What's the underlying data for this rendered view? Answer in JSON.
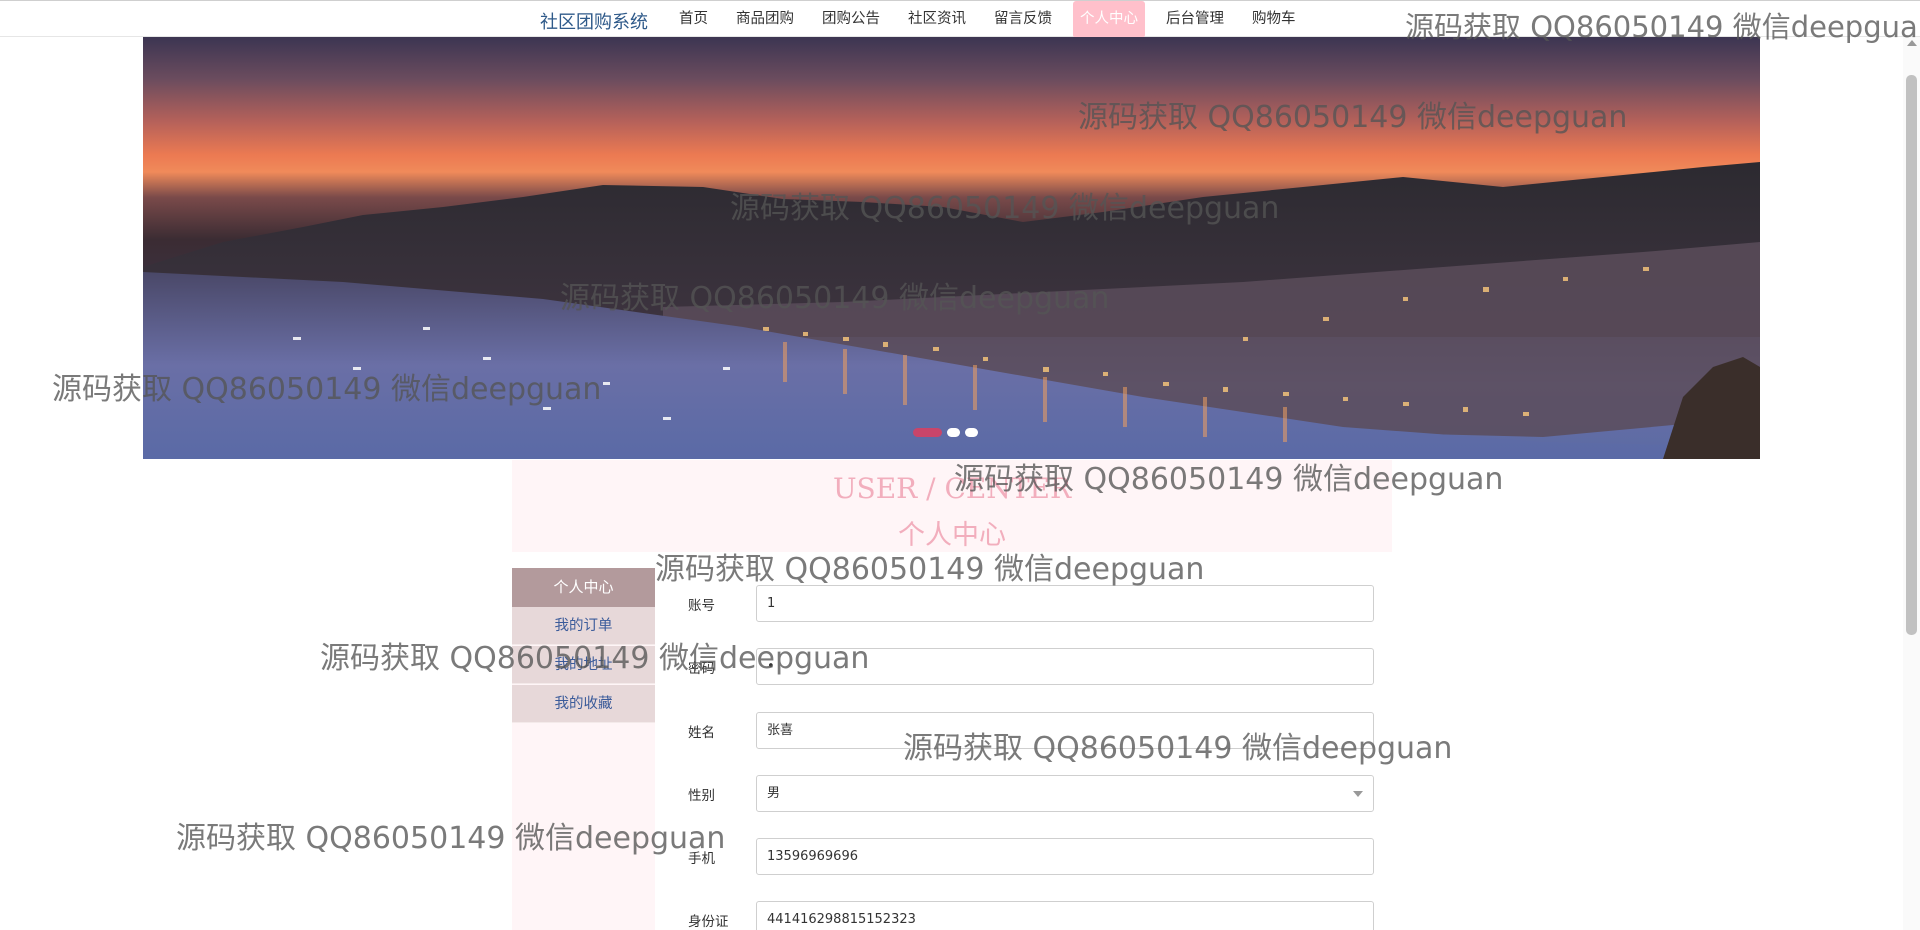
{
  "nav": {
    "brand": "社区团购系统",
    "items": [
      {
        "label": "首页"
      },
      {
        "label": "商品团购"
      },
      {
        "label": "团购公告"
      },
      {
        "label": "社区资讯"
      },
      {
        "label": "留言反馈"
      },
      {
        "label": "个人中心"
      },
      {
        "label": "后台管理"
      },
      {
        "label": "购物车"
      }
    ],
    "active": "个人中心"
  },
  "banner": {
    "slide_count": 3,
    "active_slide": 1
  },
  "heading": {
    "en": "USER / CENTER",
    "cn": "个人中心"
  },
  "sidebar": {
    "title": "个人中心",
    "items": [
      {
        "label": "我的订单"
      },
      {
        "label": "我的地址"
      },
      {
        "label": "我的收藏"
      }
    ]
  },
  "form": {
    "account": {
      "label": "账号",
      "value": "1"
    },
    "password": {
      "label": "密码",
      "value": "•"
    },
    "name": {
      "label": "姓名",
      "value": "张喜"
    },
    "gender": {
      "label": "性别",
      "value": "男"
    },
    "phone": {
      "label": "手机",
      "value": "13596969696"
    },
    "id_card": {
      "label": "身份证",
      "value": "441416298815152323"
    }
  },
  "watermark": "源码获取 QQ86050149 微信deepguan",
  "colors": {
    "accent_pink": "#ffc0cb",
    "brand_blue": "#2f5a8a",
    "sidebar_head": "#b39a9c",
    "sidebar_item": "#e7d8d9"
  }
}
